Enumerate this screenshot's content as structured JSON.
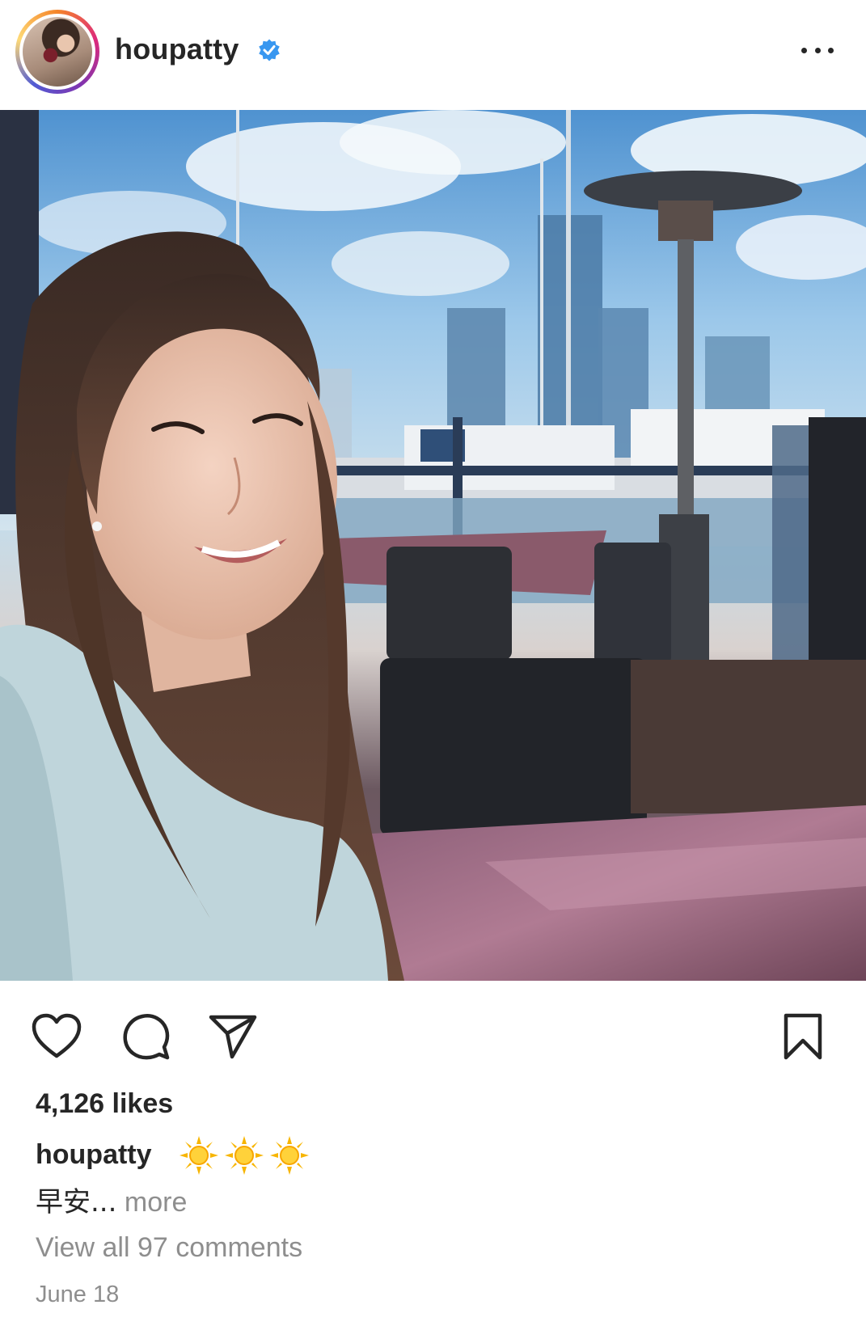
{
  "header": {
    "username": "houpatty",
    "verified": true,
    "more_icon": "more-horizontal-icon"
  },
  "post": {
    "image_alt": "selfie"
  },
  "actions": {
    "like_icon": "heart-icon",
    "comment_icon": "comment-icon",
    "share_icon": "send-icon",
    "save_icon": "bookmark-icon"
  },
  "likes": "4,126 likes",
  "caption": {
    "username": "houpatty",
    "emoji": [
      "sun-icon",
      "sun-icon",
      "sun-icon"
    ],
    "text": "早安...",
    "more_label": " more"
  },
  "comments": {
    "view_all": "View all 97 comments"
  },
  "date": "June 18",
  "colors": {
    "text": "#262626",
    "secondary": "#8e8e8e",
    "verified_blue": "#3897f0"
  }
}
